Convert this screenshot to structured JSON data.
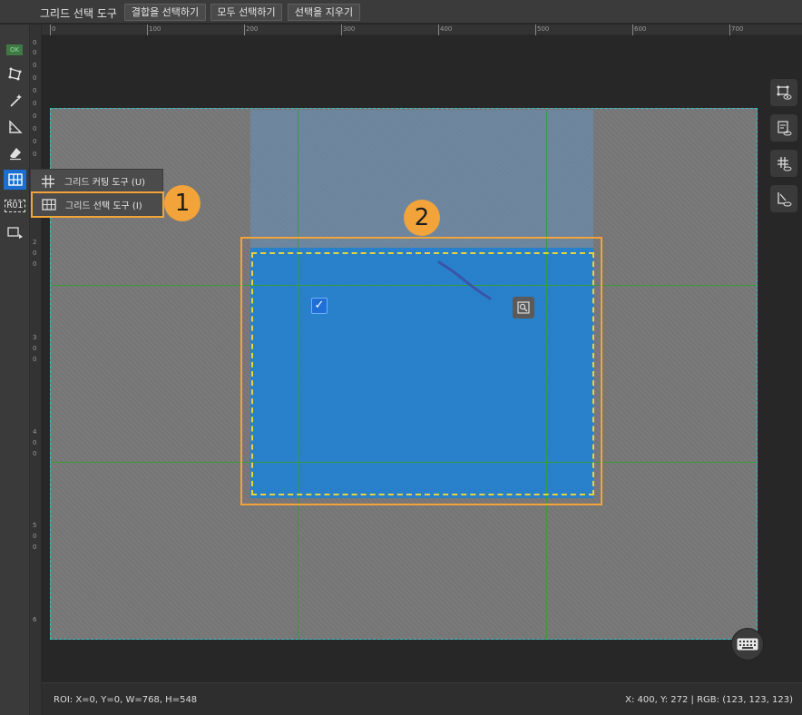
{
  "topbar": {
    "tool_title": "그리드 선택 도구",
    "buttons": [
      "결합을 선택하기",
      "모두 선택하기",
      "선택을 지우기"
    ]
  },
  "toolbar": {
    "ok_label": "OK",
    "roi_label": "ROI",
    "icons": [
      "polygon-icon",
      "magic-wand-icon",
      "ruler-icon",
      "eraser-icon",
      "grid-icon",
      "roi-icon",
      "video-icon"
    ]
  },
  "flyout": {
    "items": [
      {
        "label": "그리드 커팅 도구 (U)",
        "icon": "grid-cut-icon"
      },
      {
        "label": "그리드 선택 도구 (I)",
        "icon": "grid-select-icon"
      }
    ]
  },
  "ruler": {
    "top_labels": [
      "0",
      "100",
      "200",
      "300",
      "400",
      "500",
      "600",
      "700"
    ],
    "left_labels": [
      "0",
      "0",
      "0",
      "0",
      "0",
      "0",
      "0",
      "0",
      "0",
      "0",
      "2",
      "0",
      "0",
      "3",
      "0",
      "0",
      "4",
      "0",
      "0",
      "5",
      "0",
      "0",
      "6"
    ]
  },
  "badges": {
    "one": "1",
    "two": "2"
  },
  "check_mark": "✓",
  "right_tools": [
    "roi-view-icon",
    "annotation-view-icon",
    "grid-view-icon",
    "mask-view-icon"
  ],
  "status": {
    "roi": "ROI: X=0, Y=0, W=768, H=548",
    "cursor": "X: 400, Y: 272 | RGB: (123, 123, 123)"
  },
  "colors": {
    "accent": "#1b6fd3",
    "highlight_orange": "#f2a33a",
    "selection_dash": "#e8d43a",
    "grid_line": "#3a9a3a",
    "image_border": "#36c2c9"
  }
}
